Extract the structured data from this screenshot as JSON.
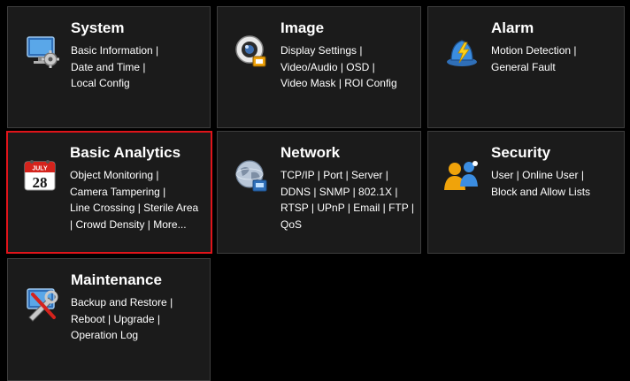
{
  "tiles": [
    {
      "title": "System",
      "icon": "system-settings-icon",
      "lines": [
        "Basic Information |",
        "Date and Time |",
        "Local Config"
      ]
    },
    {
      "title": "Image",
      "icon": "camera-image-icon",
      "lines": [
        "Display Settings |",
        "Video/Audio | OSD |",
        "Video Mask | ROI Config"
      ]
    },
    {
      "title": "Alarm",
      "icon": "alarm-bell-icon",
      "lines": [
        "Motion Detection |",
        "General Fault"
      ]
    },
    {
      "title": "Basic Analytics",
      "icon": "calendar-analytics-icon",
      "calendar_month": "JULY",
      "calendar_day": "28",
      "lines": [
        "Object Monitoring |",
        "Camera Tampering |",
        "Line Crossing | Sterile Area",
        "| Crowd Density | More..."
      ]
    },
    {
      "title": "Network",
      "icon": "network-globe-icon",
      "lines": [
        "TCP/IP | Port | Server |",
        "DDNS | SNMP | 802.1X |",
        "RTSP | UPnP | Email | FTP |",
        "QoS"
      ]
    },
    {
      "title": "Security",
      "icon": "users-security-icon",
      "lines": [
        "User | Online User |",
        "Block and Allow Lists"
      ]
    },
    {
      "title": "Maintenance",
      "icon": "maintenance-tools-icon",
      "lines": [
        "Backup and Restore |",
        "Reboot | Upgrade |",
        "Operation Log"
      ]
    }
  ],
  "selected_tile": "Basic Analytics",
  "colors": {
    "tile_background": "#1b1b1b",
    "tile_border": "#3d3d3d",
    "selected_border": "#e0141a",
    "text": "#ffffff"
  }
}
